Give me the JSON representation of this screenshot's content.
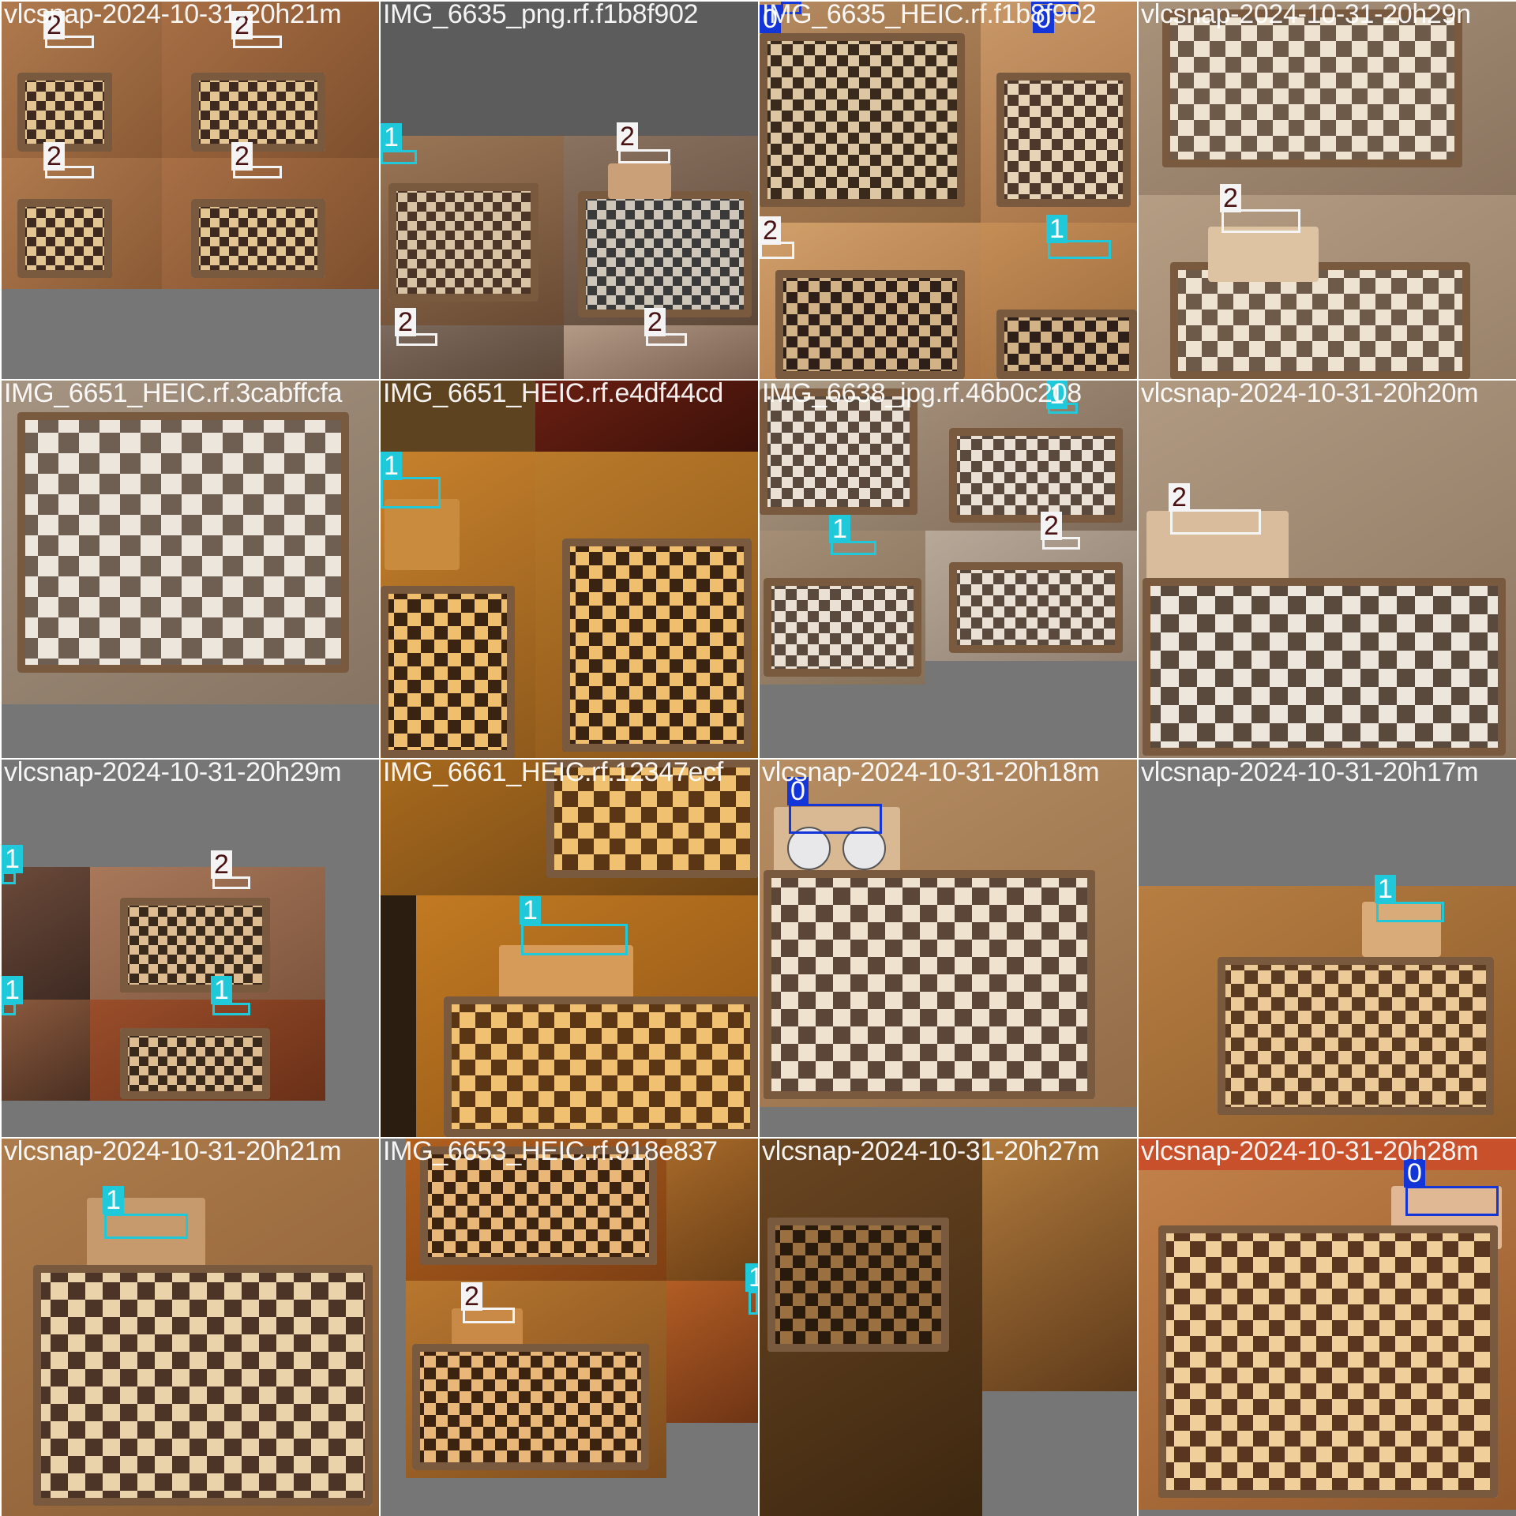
{
  "tiles": [
    {
      "title": "vlcsnap-2024-10-31-20h21m",
      "labels": [
        "2",
        "2",
        "2",
        "2"
      ]
    },
    {
      "title": "IMG_6635_png.rf.f1b8f902",
      "labels": [
        "1",
        "2",
        "2",
        "2"
      ]
    },
    {
      "title": "IMG_6635_HEIC.rf.f1b8f902",
      "labels": [
        "0",
        "0",
        "2",
        "1"
      ]
    },
    {
      "title": "vlcsnap-2024-10-31-20h29n",
      "labels": [
        "2"
      ]
    },
    {
      "title": "IMG_6651_HEIC.rf.3cabffcfa",
      "labels": []
    },
    {
      "title": "IMG_6651_HEIC.rf.e4df44cd",
      "labels": [
        "1"
      ]
    },
    {
      "title": "IMG_6638_jpg.rf.46b0c208",
      "labels": [
        "1",
        "1",
        "2"
      ]
    },
    {
      "title": "vlcsnap-2024-10-31-20h20m",
      "labels": [
        "2"
      ]
    },
    {
      "title": "vlcsnap-2024-10-31-20h29m",
      "labels": [
        "1",
        "2",
        "1",
        "1"
      ]
    },
    {
      "title": "IMG_6661_HEIC.rf.12347ecf",
      "labels": [
        "1"
      ]
    },
    {
      "title": "vlcsnap-2024-10-31-20h18m",
      "labels": [
        "0"
      ]
    },
    {
      "title": "vlcsnap-2024-10-31-20h17m",
      "labels": [
        "1"
      ]
    },
    {
      "title": "vlcsnap-2024-10-31-20h21m",
      "labels": [
        "1"
      ]
    },
    {
      "title": "IMG_6653_HEIC.rf.918e837",
      "labels": [
        "2",
        "1"
      ]
    },
    {
      "title": "vlcsnap-2024-10-31-20h27m",
      "labels": []
    },
    {
      "title": "vlcsnap-2024-10-31-20h28m",
      "labels": [
        "0"
      ]
    }
  ],
  "colors": {
    "class_0": "#1436d8",
    "class_1": "#1fc9d9",
    "class_2": "#f4f4f4",
    "padding": "#767676"
  }
}
